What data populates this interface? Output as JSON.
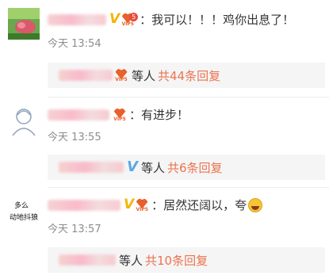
{
  "comments": [
    {
      "text": "：我可以！！！鸡你出息了！",
      "time": "今天 13:54",
      "reply_etc": "等人",
      "reply_count": "共44条回复",
      "badge": "V",
      "vip_label": "VIP5",
      "vip_level": "5"
    },
    {
      "text": "：有进步！",
      "time": "今天 13:55",
      "reply_etc": "等人",
      "reply_count": "共6条回复",
      "badge": "V",
      "vip_label": "VIP5"
    },
    {
      "text": "：居然还阔以，夸",
      "time": "今天 13:57",
      "reply_etc": "等人",
      "reply_count": "共10条回复",
      "badge": "V",
      "vip_label": "VIP5",
      "avatar_text": [
        "多么",
        "动地抖狼"
      ]
    }
  ],
  "colors": {
    "accent": "#eb7350",
    "verified": "#f5b400",
    "timestamp": "#8c8c8c",
    "reply_bg": "#f5f5f5"
  },
  "icons": [
    "verified-v-icon",
    "vip-heart-icon",
    "laughing-emoji-icon",
    "avatar-image"
  ]
}
